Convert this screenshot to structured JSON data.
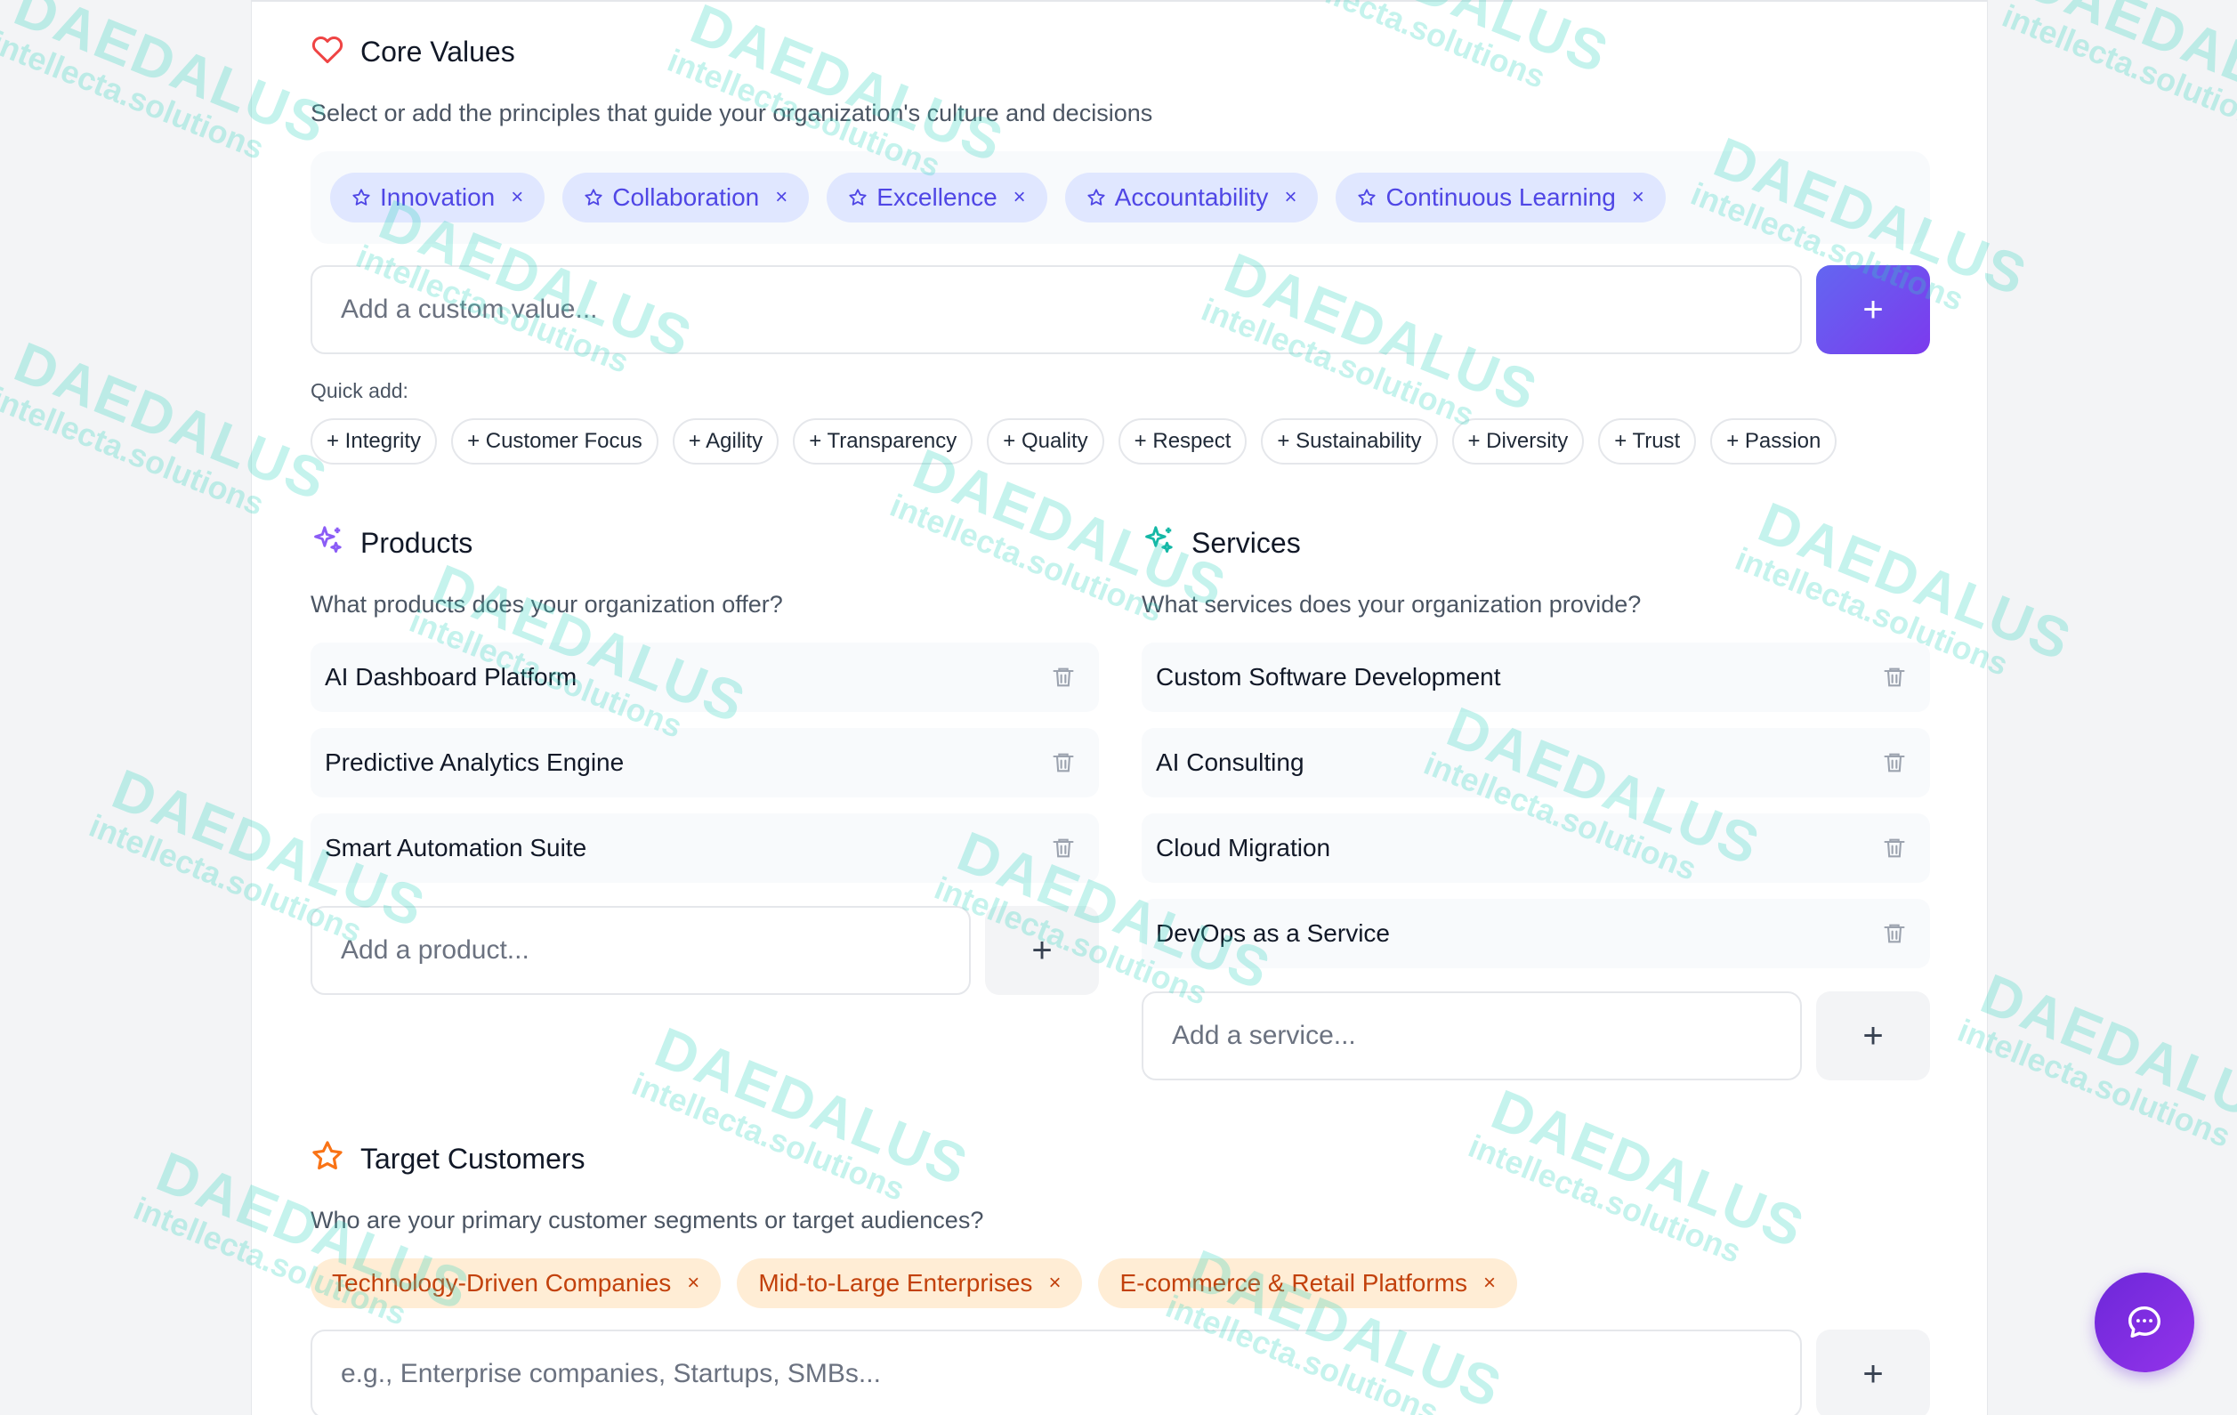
{
  "core_values": {
    "title": "Core Values",
    "description": "Select or add the principles that guide your organization's culture and decisions",
    "tags": [
      "Innovation",
      "Collaboration",
      "Excellence",
      "Accountability",
      "Continuous Learning"
    ],
    "remove_glyph": "×",
    "input_placeholder": "Add a custom value...",
    "add_glyph": "+",
    "quick_add_label": "Quick add:",
    "quick_add": [
      "+ Integrity",
      "+ Customer Focus",
      "+ Agility",
      "+ Transparency",
      "+ Quality",
      "+ Respect",
      "+ Sustainability",
      "+ Diversity",
      "+ Trust",
      "+ Passion"
    ]
  },
  "products": {
    "title": "Products",
    "description": "What products does your organization offer?",
    "items": [
      "AI Dashboard Platform",
      "Predictive Analytics Engine",
      "Smart Automation Suite"
    ],
    "input_placeholder": "Add a product...",
    "add_glyph": "+"
  },
  "services": {
    "title": "Services",
    "description": "What services does your organization provide?",
    "items": [
      "Custom Software Development",
      "AI Consulting",
      "Cloud Migration",
      "DevOps as a Service"
    ],
    "input_placeholder": "Add a service...",
    "add_glyph": "+"
  },
  "target_customers": {
    "title": "Target Customers",
    "description": "Who are your primary customer segments or target audiences?",
    "tags": [
      "Technology-Driven Companies",
      "Mid-to-Large Enterprises",
      "E-commerce & Retail Platforms"
    ],
    "remove_glyph": "×",
    "input_placeholder": "e.g., Enterprise companies, Startups, SMBs...",
    "add_glyph": "+"
  },
  "watermark": {
    "brand": "DAEDALUS",
    "domain": "intellecta.solutions"
  },
  "colors": {
    "accent": "#6366f1",
    "heart": "#ef4444",
    "products_icon": "#8b5cf6",
    "services_icon": "#14b8a6",
    "customers_icon": "#f97316",
    "tag_bg": "#e0e7ff",
    "customer_tag_bg": "#ffedd5"
  }
}
